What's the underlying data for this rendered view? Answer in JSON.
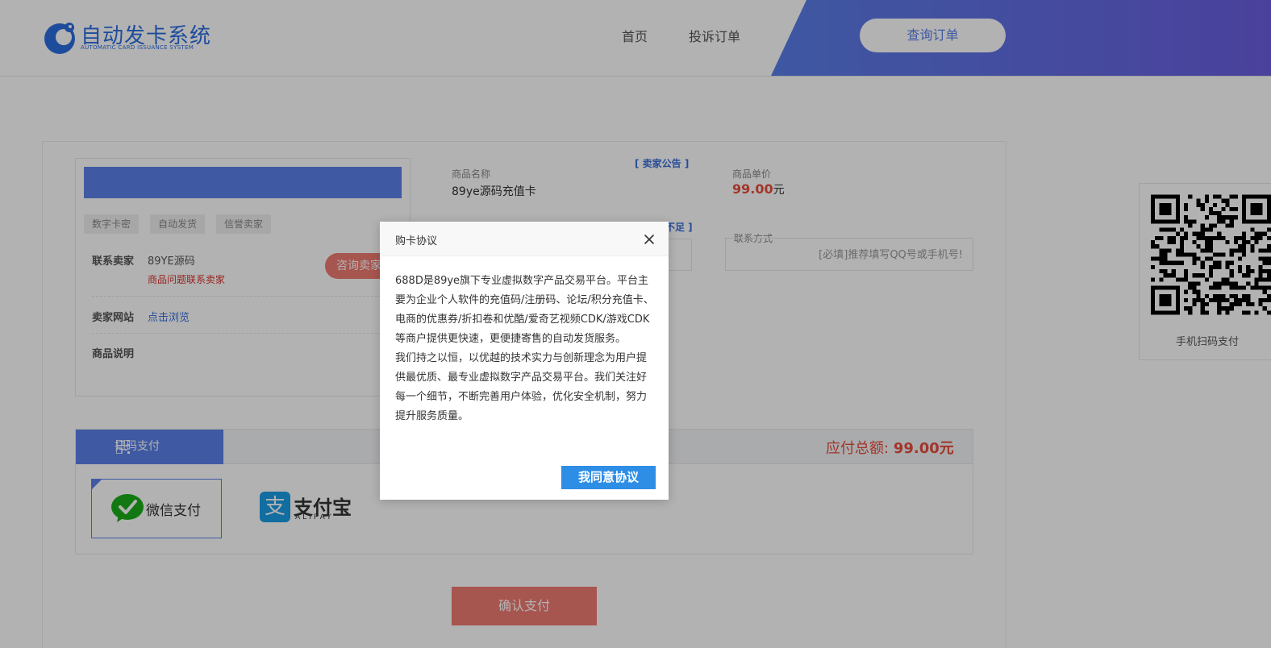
{
  "brand": {
    "title": "自动发卡系统",
    "subtitle": "AUTOMATIC CARD ISSUANCE SYSTEM",
    "color": "#2c6ee0"
  },
  "nav": {
    "home": "首页",
    "complaint": "投诉订单",
    "query_button": "查询订单"
  },
  "seller": {
    "tags": [
      "数字卡密",
      "自动发货",
      "信誉卖家"
    ],
    "contact_label": "联系卖家",
    "contact_name": "89YE源码",
    "contact_hint": "商品问题联系卖家",
    "consult_button": "咨询卖家",
    "website_label": "卖家网站",
    "website_link": "点击浏览",
    "description_label": "商品说明"
  },
  "product": {
    "name_label": "商品名称",
    "name": "89ye源码充值卡",
    "notice_link": "[ 卖家公告 ]",
    "stock_link": "不足 ]",
    "price_label": "商品单价",
    "price": "99.00",
    "price_unit": "元",
    "contact_label": "联系方式",
    "contact_placeholder": "[必填]推荐填写QQ号或手机号!"
  },
  "payment": {
    "tab_label": "扫码支付",
    "total_label": "应付总额:",
    "total_value": "99.00元",
    "wechat_label": "微信支付",
    "alipay_label": "支付宝",
    "alipay_en": "ALIPAY",
    "confirm_button": "确认支付"
  },
  "qr": {
    "label": "手机扫码支付"
  },
  "modal": {
    "title": "购卡协议",
    "paragraph1": "688D是89ye旗下专业虚拟数字产品交易平台。平台主要为企业个人软件的充值码/注册码、论坛/积分充值卡、电商的优惠券/折扣卷和优酷/爱奇艺视频CDK/游戏CDK等商户提供更快速，更便捷寄售的自动发货服务。",
    "paragraph2": "我们持之以恒，以优越的技术实力与创新理念为用户提供最优质、最专业虚拟数字产品交易平台。我们关注好每一个细节，不断完善用户体验，优化安全机制，努力提升服务质量。",
    "agree_button": "我同意协议"
  },
  "colors": {
    "accent": "#5b80e8",
    "danger": "#e84c3d",
    "button_red": "#f07a72",
    "agree_blue": "#2e8ee6"
  }
}
